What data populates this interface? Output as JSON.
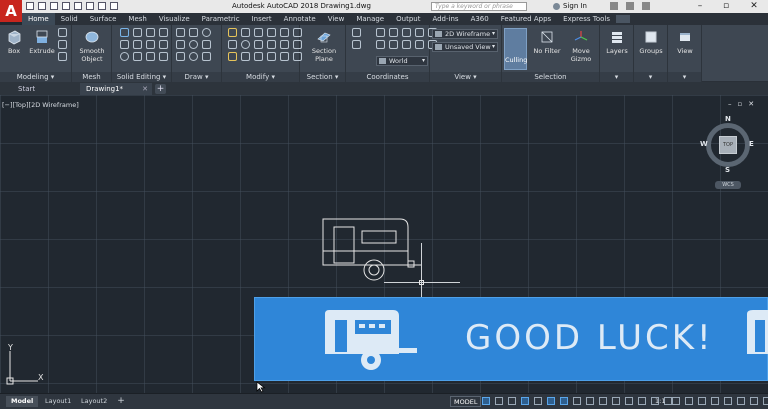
{
  "title_bar": {
    "app_letter": "A",
    "title": "Autodesk AutoCAD 2018   Drawing1.dwg",
    "search_placeholder": "Type a keyword or phrase",
    "signin": "Sign In",
    "minimize": "–",
    "restore": "▫",
    "close": "✕"
  },
  "ribbon_tabs": [
    "Home",
    "Solid",
    "Surface",
    "Mesh",
    "Visualize",
    "Parametric",
    "Insert",
    "Annotate",
    "View",
    "Manage",
    "Output",
    "Add-ins",
    "A360",
    "Featured Apps",
    "Express Tools"
  ],
  "ribbon": {
    "modeling": {
      "label": "Modeling ▾",
      "box": "Box",
      "extrude": "Extrude"
    },
    "mesh": {
      "label": "Mesh",
      "smooth": "Smooth Object"
    },
    "solid_editing": {
      "label": "Solid Editing ▾"
    },
    "draw": {
      "label": "Draw ▾"
    },
    "modify": {
      "label": "Modify ▾"
    },
    "section": {
      "label": "Section ▾",
      "plane": "Section Plane"
    },
    "coordinates": {
      "label": "Coordinates",
      "world": "World"
    },
    "view": {
      "label": "View ▾",
      "visual_style": "2D Wireframe",
      "saved_view": "Unsaved View"
    },
    "selection": {
      "label": "Selection",
      "culling": "Culling",
      "no_filter": "No Filter",
      "move_gizmo": "Move Gizmo"
    },
    "layers": {
      "label": "Layers"
    },
    "groups": {
      "label": "Groups"
    },
    "view_panel": {
      "label": "View"
    }
  },
  "doc_tabs": {
    "start": "Start",
    "drawing": "Drawing1*",
    "close": "✕",
    "add": "+"
  },
  "canvas": {
    "viewport_label": "[−][Top][2D Wireframe]",
    "compass": {
      "n": "N",
      "s": "S",
      "e": "E",
      "w": "W",
      "top": "TOP"
    },
    "wcs": "WCS",
    "banner_text": "GOOD  LUCK!",
    "ucs": {
      "x": "X",
      "y": "Y"
    }
  },
  "layout_tabs": {
    "model": "Model",
    "layout1": "Layout1",
    "layout2": "Layout2",
    "add": "+"
  },
  "status_bar": {
    "model": "MODEL",
    "scale": "1:1"
  }
}
